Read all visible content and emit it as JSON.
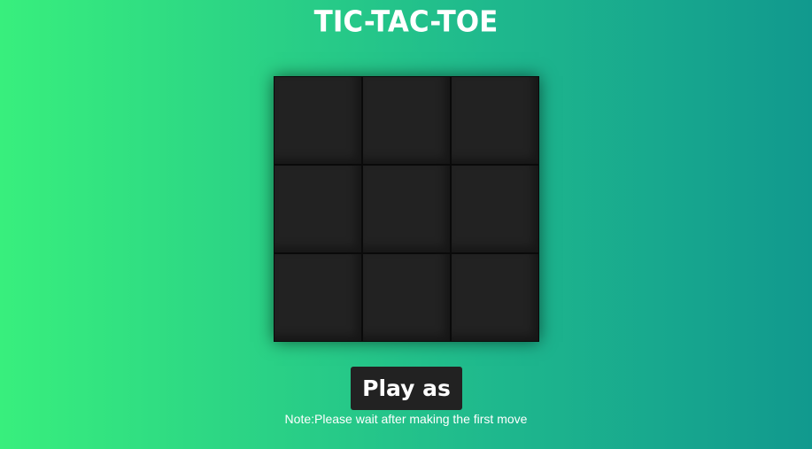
{
  "header": {
    "title": "TIC-TAC-TOE"
  },
  "board": {
    "cells": [
      "",
      "",
      "",
      "",
      "",
      "",
      "",
      "",
      ""
    ]
  },
  "controls": {
    "play_label": "Play as"
  },
  "footer": {
    "note": "Note:Please wait after making the first move"
  },
  "colors": {
    "gradient_start": "#38ef7d",
    "gradient_end": "#11998e",
    "cell": "#222222",
    "button": "#222222",
    "text": "#ffffff"
  }
}
